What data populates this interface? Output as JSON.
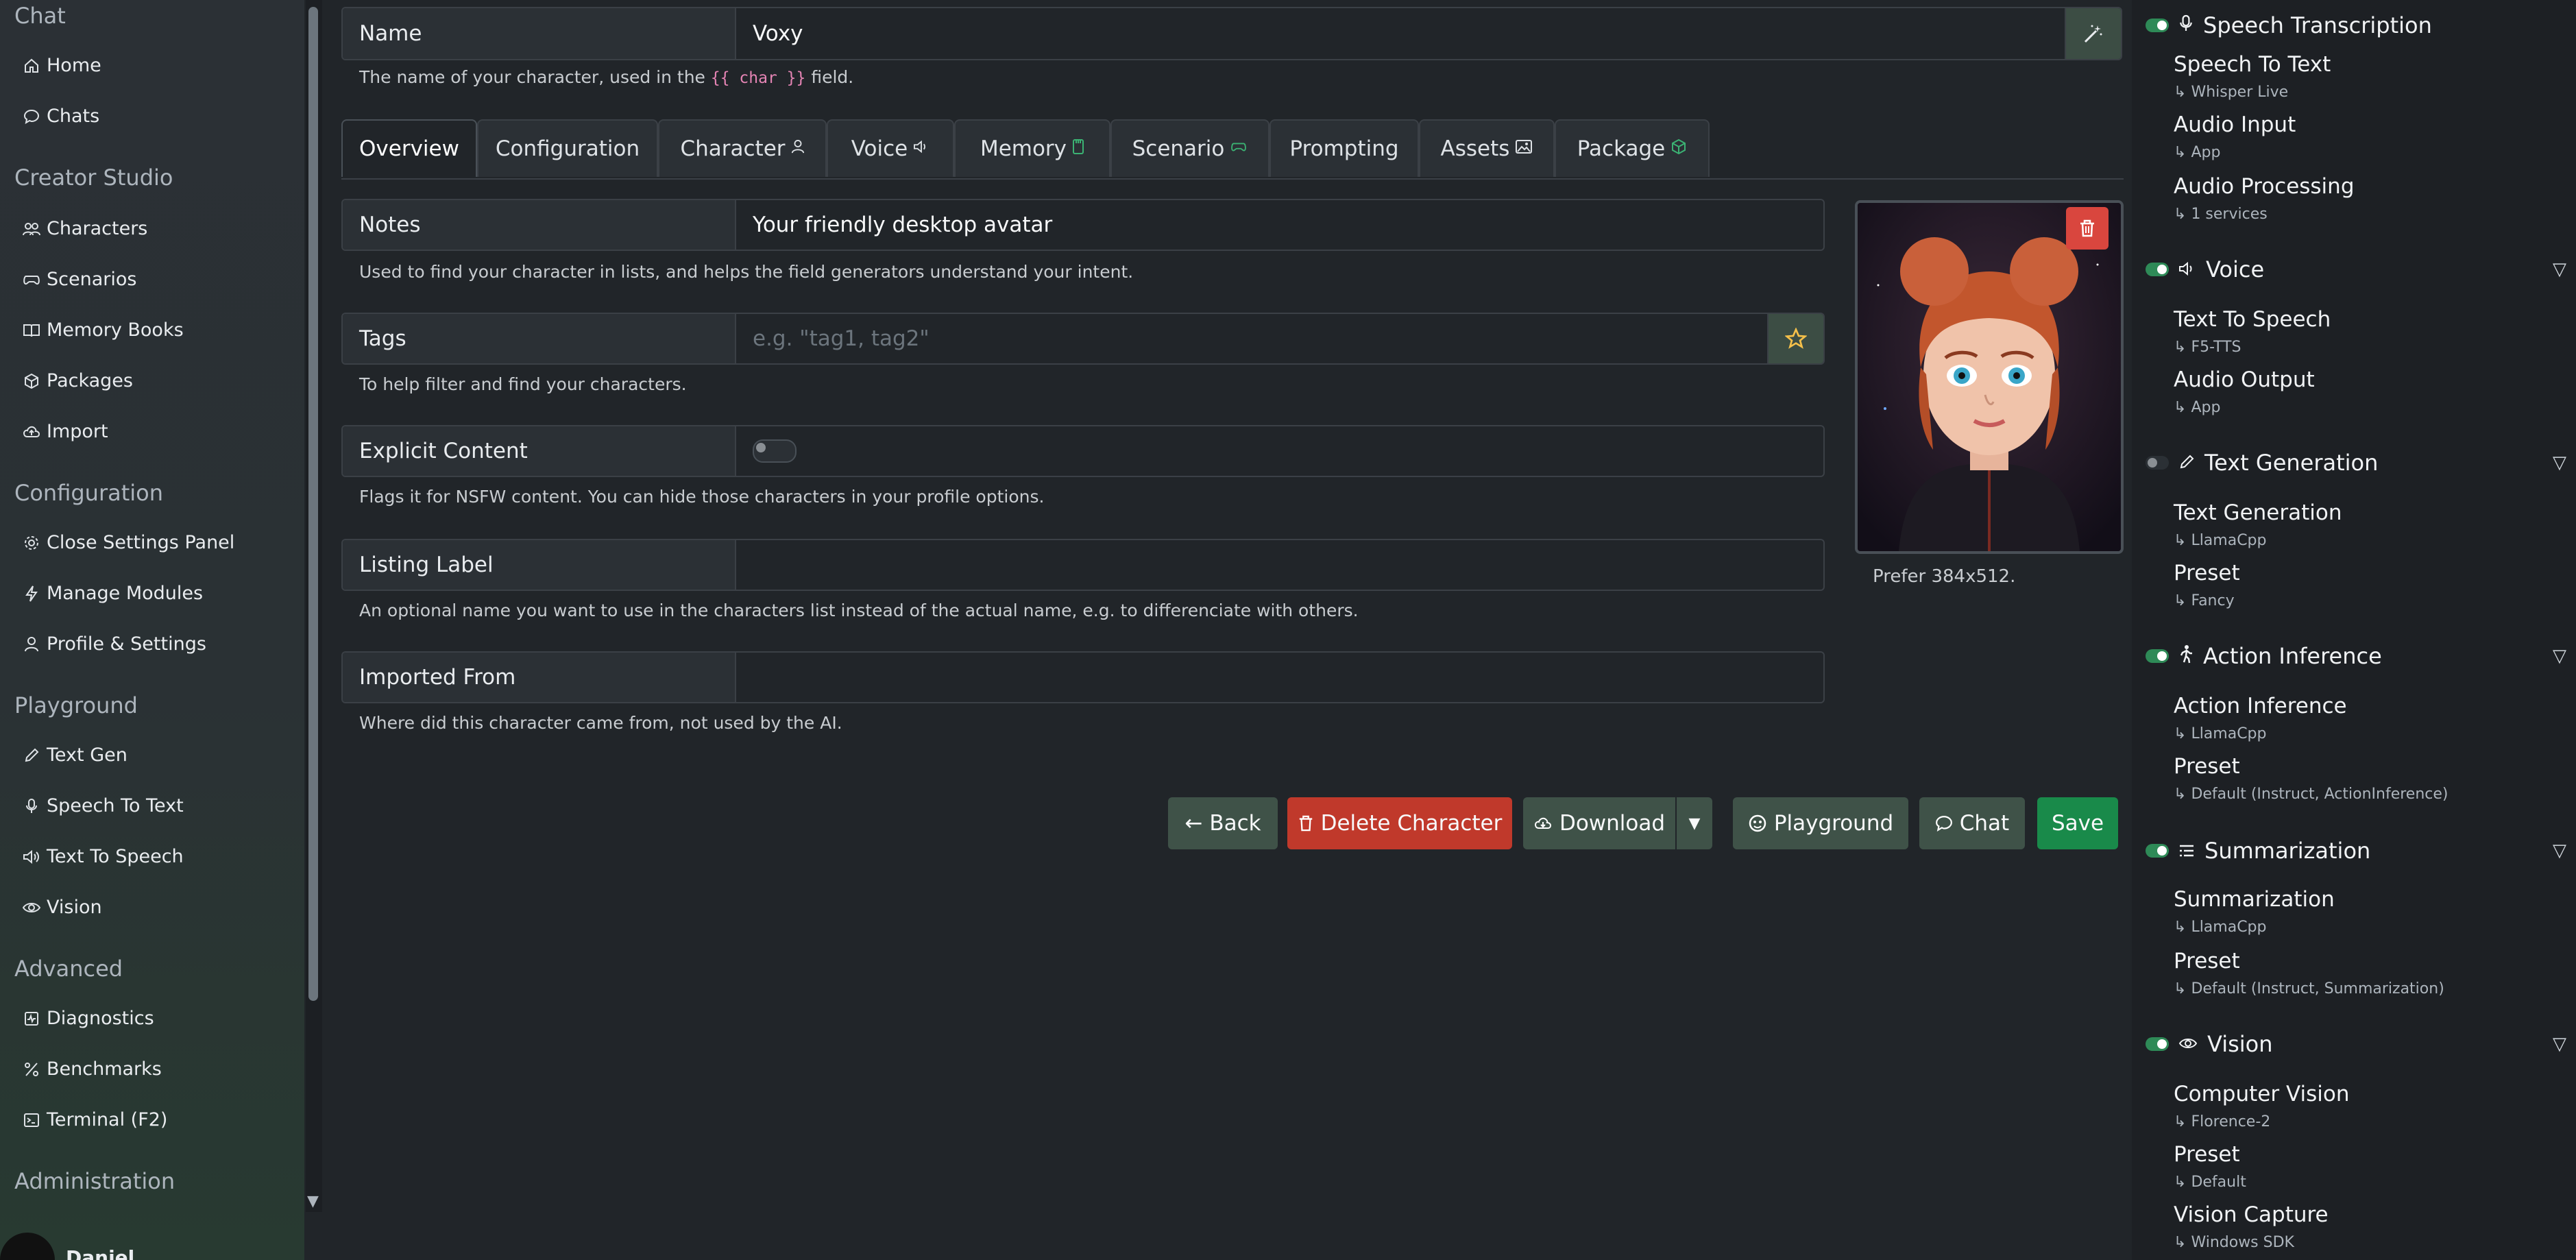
{
  "sidebar": {
    "sections": [
      {
        "title": "Chat",
        "items": [
          {
            "label": "Home",
            "icon": "home-icon"
          },
          {
            "label": "Chats",
            "icon": "chat-bubble-icon"
          }
        ]
      },
      {
        "title": "Creator Studio",
        "items": [
          {
            "label": "Characters",
            "icon": "people-icon"
          },
          {
            "label": "Scenarios",
            "icon": "gamepad-icon"
          },
          {
            "label": "Memory Books",
            "icon": "book-icon"
          },
          {
            "label": "Packages",
            "icon": "box-icon"
          },
          {
            "label": "Import",
            "icon": "cloud-upload-icon"
          }
        ]
      },
      {
        "title": "Configuration",
        "items": [
          {
            "label": "Close Settings Panel",
            "icon": "gear-icon"
          },
          {
            "label": "Manage Modules",
            "icon": "lightning-icon"
          },
          {
            "label": "Profile & Settings",
            "icon": "person-icon"
          }
        ]
      },
      {
        "title": "Playground",
        "items": [
          {
            "label": "Text Gen",
            "icon": "pencil-icon"
          },
          {
            "label": "Speech To Text",
            "icon": "microphone-icon"
          },
          {
            "label": "Text To Speech",
            "icon": "speaker-icon"
          },
          {
            "label": "Vision",
            "icon": "eye-icon"
          }
        ]
      },
      {
        "title": "Advanced",
        "items": [
          {
            "label": "Diagnostics",
            "icon": "diagnostics-icon"
          },
          {
            "label": "Benchmarks",
            "icon": "percent-icon"
          },
          {
            "label": "Terminal (F2)",
            "icon": "terminal-icon"
          }
        ]
      },
      {
        "title": "Administration",
        "items": []
      }
    ],
    "username": "Daniel..."
  },
  "form": {
    "name": {
      "label": "Name",
      "value": "Voxy",
      "help_pre": "The name of your character, used in the",
      "help_code": "{{ char }}",
      "help_post": "field."
    },
    "tabs": [
      {
        "label": "Overview",
        "icon": ""
      },
      {
        "label": "Configuration",
        "icon": ""
      },
      {
        "label": "Character",
        "icon": "person-icon"
      },
      {
        "label": "Voice",
        "icon": "speaker-icon"
      },
      {
        "label": "Memory",
        "icon": "memory-card-icon"
      },
      {
        "label": "Scenario",
        "icon": "gamepad-icon"
      },
      {
        "label": "Prompting",
        "icon": ""
      },
      {
        "label": "Assets",
        "icon": "image-icon"
      },
      {
        "label": "Package",
        "icon": "box-icon"
      }
    ],
    "notes": {
      "label": "Notes",
      "value": "Your friendly desktop avatar",
      "help": "Used to find your character in lists, and helps the field generators understand your intent."
    },
    "tags": {
      "label": "Tags",
      "placeholder": "e.g. \"tag1, tag2\"",
      "help": "To help filter and find your characters."
    },
    "explicit": {
      "label": "Explicit Content",
      "enabled": false,
      "help": "Flags it for NSFW content. You can hide those characters in your profile options."
    },
    "listing_label": {
      "label": "Listing Label",
      "value": "",
      "help": "An optional name you want to use in the characters list instead of the actual name, e.g. to differenciate with others."
    },
    "imported_from": {
      "label": "Imported From",
      "value": "",
      "help": "Where did this character came from, not used by the AI."
    },
    "avatar_hint": "Prefer 384x512."
  },
  "actions": {
    "back": "Back",
    "delete": "Delete Character",
    "download": "Download",
    "playground": "Playground",
    "chat": "Chat",
    "save": "Save"
  },
  "modules": [
    {
      "title": "Speech Transcription",
      "icon": "microphone-icon",
      "enabled": true,
      "caret": false,
      "services": [
        {
          "name": "Speech To Text",
          "value": "Whisper Live"
        },
        {
          "name": "Audio Input",
          "value": "App"
        },
        {
          "name": "Audio Processing",
          "value": "1 services"
        }
      ]
    },
    {
      "title": "Voice",
      "icon": "speaker-icon",
      "enabled": true,
      "caret": true,
      "services": [
        {
          "name": "Text To Speech",
          "value": "F5-TTS"
        },
        {
          "name": "Audio Output",
          "value": "App"
        }
      ]
    },
    {
      "title": "Text Generation",
      "icon": "pencil-icon",
      "enabled": false,
      "caret": true,
      "services": [
        {
          "name": "Text Generation",
          "value": "LlamaCpp"
        },
        {
          "name": "Preset",
          "value": "Fancy"
        }
      ]
    },
    {
      "title": "Action Inference",
      "icon": "running-person-icon",
      "enabled": true,
      "caret": true,
      "services": [
        {
          "name": "Action Inference",
          "value": "LlamaCpp"
        },
        {
          "name": "Preset",
          "value": "Default (Instruct, ActionInference)"
        }
      ]
    },
    {
      "title": "Summarization",
      "icon": "list-icon",
      "enabled": true,
      "caret": true,
      "services": [
        {
          "name": "Summarization",
          "value": "LlamaCpp"
        },
        {
          "name": "Preset",
          "value": "Default (Instruct, Summarization)"
        }
      ]
    },
    {
      "title": "Vision",
      "icon": "eye-icon",
      "enabled": true,
      "caret": true,
      "services": [
        {
          "name": "Computer Vision",
          "value": "Florence-2"
        },
        {
          "name": "Preset",
          "value": "Default"
        },
        {
          "name": "Vision Capture",
          "value": "Windows SDK"
        }
      ]
    }
  ],
  "colors": {
    "accent": "#3bb273",
    "danger": "#c0392b",
    "success": "#198a4a",
    "secondary": "#3f5248"
  }
}
